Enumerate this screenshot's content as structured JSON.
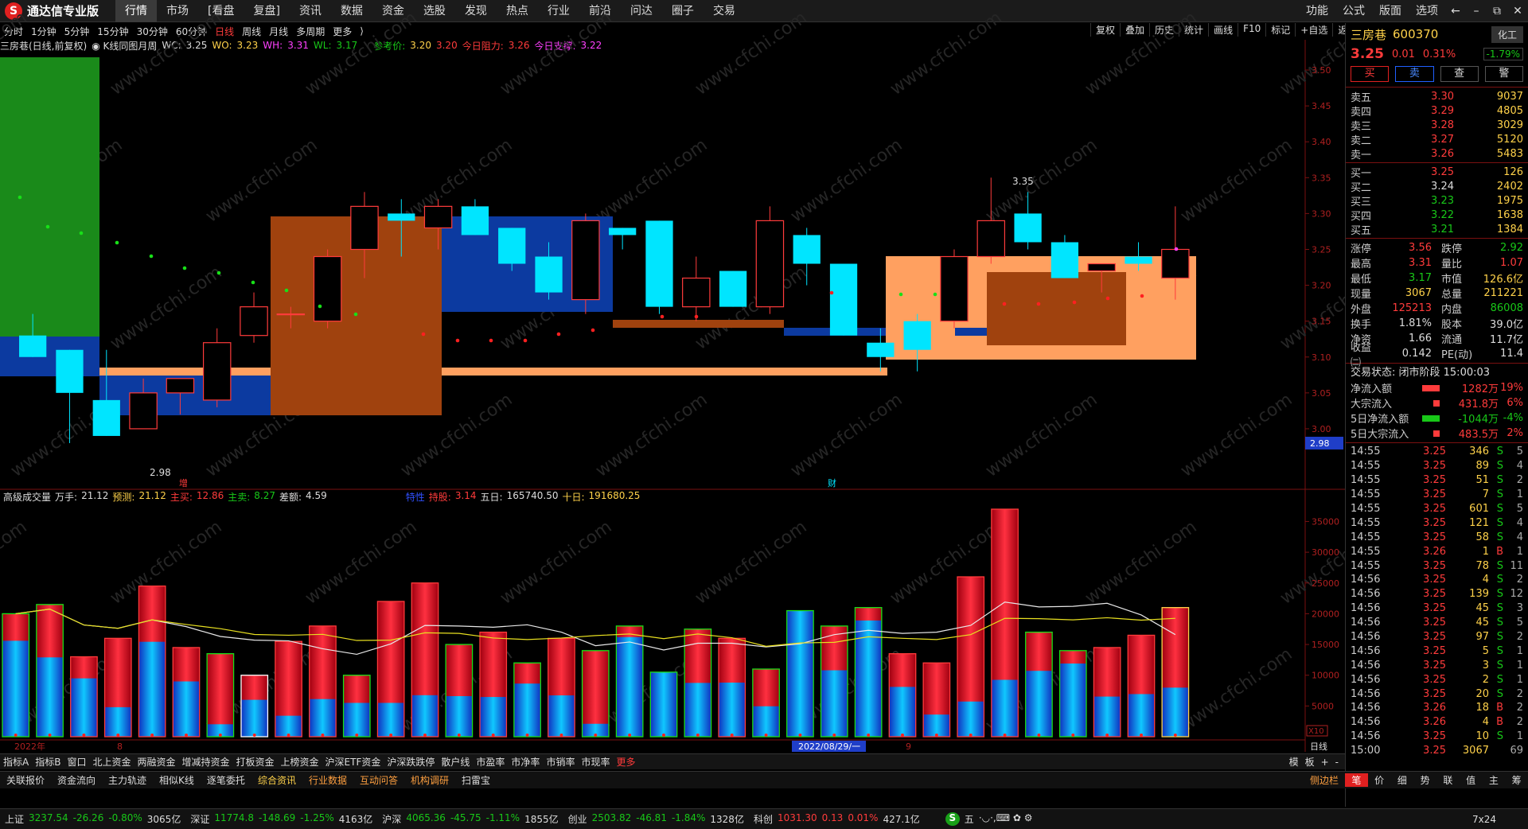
{
  "app": {
    "logo_mark": "S",
    "title": "通达信专业版"
  },
  "menu": [
    "行情",
    "市场",
    "[看盘",
    "复盘]",
    "资讯",
    "数据",
    "资金",
    "选股",
    "发现",
    "热点",
    "行业",
    "前沿",
    "问达",
    "圈子",
    "交易"
  ],
  "menu_right": [
    "功能",
    "公式",
    "版面",
    "选项"
  ],
  "window_btns": [
    "←",
    "–",
    "⧉",
    "✕"
  ],
  "periods": [
    "分时",
    "1分钟",
    "5分钟",
    "15分钟",
    "30分钟",
    "60分钟",
    "日线",
    "周线",
    "月线",
    "多周期",
    "更多"
  ],
  "period_more_arrow": "⟩",
  "active_period": "日线",
  "toolbar_right": [
    "复权",
    "叠加",
    "历史",
    "统计",
    "画线",
    "F10",
    "标记",
    "+自选",
    "返回"
  ],
  "info": {
    "stock": "三房巷(日线,前复权)",
    "indicator": "K线同图月周",
    "wc_label": "WC:",
    "wc": "3.25",
    "wo_label": "WO:",
    "wo": "3.23",
    "wh_label": "WH:",
    "wh": "3.31",
    "wl_label": "WL:",
    "wl": "3.17",
    "ref_label": "参考价:",
    "ref1": "3.20",
    "ref2": "3.20",
    "res_label": "今日阻力:",
    "res": "3.26",
    "sup_label": "今日支撑:",
    "sup": "3.22"
  },
  "vol_info": {
    "name": "高级成交量",
    "wan_label": "万手:",
    "wan": "21.12",
    "pred_label": "预测:",
    "pred": "21.12",
    "zm_label": "主买:",
    "zm": "12.86",
    "zs_label": "主卖:",
    "zs": "8.27",
    "diff_label": "差额:",
    "diff": "4.59",
    "c1": "特性",
    "c2_label": "持股:",
    "c2": "3.14",
    "d5_label": "五日:",
    "d5": "165740.50",
    "d10_label": "十日:",
    "d10": "191680.25"
  },
  "price_axis": [
    "3.50",
    "3.45",
    "3.40",
    "3.35",
    "3.30",
    "3.25",
    "3.20",
    "3.15",
    "3.10",
    "3.05",
    "3.00"
  ],
  "price_tag": "2.98",
  "vol_axis": [
    "35000",
    "30000",
    "25000",
    "20000",
    "15000",
    "10000",
    "5000"
  ],
  "x10": "X10",
  "chart_marks": {
    "hi": "3.35",
    "lo": "2.98",
    "zeng": "增",
    "cai": "财"
  },
  "dates": {
    "year": "2022年",
    "m8": "8",
    "cursor": "2022/08/29/一",
    "m9": "9",
    "period": "日线"
  },
  "chart_data": {
    "type": "candlestick",
    "ylim": [
      2.96,
      3.52
    ],
    "candles": [
      {
        "o": 3.13,
        "h": 3.16,
        "l": 3.1,
        "c": 3.1
      },
      {
        "o": 3.11,
        "h": 3.11,
        "l": 2.98,
        "c": 3.05
      },
      {
        "o": 3.04,
        "h": 3.11,
        "l": 2.99,
        "c": 2.99
      },
      {
        "o": 3.0,
        "h": 3.07,
        "l": 3.0,
        "c": 3.05
      },
      {
        "o": 3.05,
        "h": 3.05,
        "l": 3.02,
        "c": 3.07
      },
      {
        "o": 3.04,
        "h": 3.14,
        "l": 3.03,
        "c": 3.12
      },
      {
        "o": 3.13,
        "h": 3.19,
        "l": 3.12,
        "c": 3.17
      },
      {
        "o": 3.16,
        "h": 3.17,
        "l": 3.14,
        "c": 3.16
      },
      {
        "o": 3.15,
        "h": 3.25,
        "l": 3.14,
        "c": 3.24
      },
      {
        "o": 3.25,
        "h": 3.33,
        "l": 3.21,
        "c": 3.31
      },
      {
        "o": 3.3,
        "h": 3.32,
        "l": 3.24,
        "c": 3.29
      },
      {
        "o": 3.28,
        "h": 3.32,
        "l": 3.25,
        "c": 3.31
      },
      {
        "o": 3.31,
        "h": 3.32,
        "l": 3.27,
        "c": 3.27
      },
      {
        "o": 3.28,
        "h": 3.28,
        "l": 3.22,
        "c": 3.23
      },
      {
        "o": 3.24,
        "h": 3.26,
        "l": 3.18,
        "c": 3.19
      },
      {
        "o": 3.18,
        "h": 3.3,
        "l": 3.16,
        "c": 3.29
      },
      {
        "o": 3.28,
        "h": 3.28,
        "l": 3.25,
        "c": 3.27
      },
      {
        "o": 3.29,
        "h": 3.29,
        "l": 3.16,
        "c": 3.17
      },
      {
        "o": 3.17,
        "h": 3.24,
        "l": 3.15,
        "c": 3.21
      },
      {
        "o": 3.22,
        "h": 3.22,
        "l": 3.17,
        "c": 3.17
      },
      {
        "o": 3.17,
        "h": 3.31,
        "l": 3.16,
        "c": 3.29
      },
      {
        "o": 3.27,
        "h": 3.28,
        "l": 3.2,
        "c": 3.23
      },
      {
        "o": 3.23,
        "h": 3.23,
        "l": 3.13,
        "c": 3.13
      },
      {
        "o": 3.12,
        "h": 3.14,
        "l": 3.08,
        "c": 3.1
      },
      {
        "o": 3.15,
        "h": 3.16,
        "l": 3.08,
        "c": 3.11
      },
      {
        "o": 3.15,
        "h": 3.25,
        "l": 3.14,
        "c": 3.24
      },
      {
        "o": 3.24,
        "h": 3.35,
        "l": 3.23,
        "c": 3.29
      },
      {
        "o": 3.3,
        "h": 3.33,
        "l": 3.25,
        "c": 3.26
      },
      {
        "o": 3.26,
        "h": 3.27,
        "l": 3.21,
        "c": 3.21
      },
      {
        "o": 3.22,
        "h": 3.23,
        "l": 3.19,
        "c": 3.23
      },
      {
        "o": 3.24,
        "h": 3.26,
        "l": 3.22,
        "c": 3.23
      },
      {
        "o": 3.21,
        "h": 3.31,
        "l": 3.18,
        "c": 3.25
      }
    ],
    "volumes": [
      20000,
      21500,
      13000,
      16000,
      24500,
      14500,
      13500,
      10000,
      15500,
      18000,
      10000,
      22000,
      25000,
      15000,
      17000,
      12000,
      16000,
      14000,
      18000,
      10500,
      17500,
      16000,
      11000,
      20500,
      18000,
      21000,
      13500,
      12000,
      26000,
      37000,
      17000,
      14000,
      14500,
      16500,
      21000
    ],
    "vol_split": [
      0.78,
      0.6,
      0.73,
      0.3,
      0.63,
      0.62,
      0.15,
      0.6,
      0.22,
      0.34,
      0.55,
      0.25,
      0.27,
      0.44,
      0.38,
      0.72,
      0.42,
      0.15,
      0.9,
      1.0,
      0.5,
      0.55,
      0.45,
      1.0,
      0.6,
      0.9,
      0.6,
      0.3,
      0.22,
      0.25,
      0.63,
      0.85,
      0.45,
      0.42,
      0.38
    ],
    "ylim_vol": [
      0,
      37000
    ]
  },
  "stock": {
    "name": "三房巷",
    "code": "600370",
    "btn": "化工",
    "price": "3.25",
    "chg": "0.01",
    "pct": "0.31%",
    "sector_pct": "-1.79%",
    "trade_btns": [
      "买",
      "卖",
      "查",
      "警"
    ],
    "asks": [
      [
        "卖五",
        "3.30",
        "9037"
      ],
      [
        "卖四",
        "3.29",
        "4805"
      ],
      [
        "卖三",
        "3.28",
        "3029"
      ],
      [
        "卖二",
        "3.27",
        "5120"
      ],
      [
        "卖一",
        "3.26",
        "5483"
      ]
    ],
    "bids": [
      [
        "买一",
        "3.25",
        "126"
      ],
      [
        "买二",
        "3.24",
        "2402"
      ],
      [
        "买三",
        "3.23",
        "1975"
      ],
      [
        "买四",
        "3.22",
        "1638"
      ],
      [
        "买五",
        "3.21",
        "1384"
      ]
    ],
    "stats": [
      [
        "涨停",
        "3.56",
        "跌停",
        "2.92"
      ],
      [
        "最高",
        "3.31",
        "量比",
        "1.07"
      ],
      [
        "最低",
        "3.17",
        "市值",
        "126.6亿"
      ],
      [
        "现量",
        "3067",
        "总量",
        "211221"
      ],
      [
        "外盘",
        "125213",
        "内盘",
        "86008"
      ],
      [
        "换手",
        "1.81%",
        "股本",
        "39.0亿"
      ],
      [
        "净资",
        "1.66",
        "流通",
        "11.7亿"
      ],
      [
        "收益㈡",
        "0.142",
        "PE(动)",
        "11.4"
      ]
    ],
    "trade_status": "交易状态: 闭市阶段 15:00:03",
    "flows": [
      [
        "净流入额",
        "1282万",
        "19%"
      ],
      [
        "大宗流入",
        "431.8万",
        "6%"
      ],
      [
        "5日净流入额",
        "-1044万",
        "-4%"
      ],
      [
        "5日大宗流入",
        "483.5万",
        "2%"
      ]
    ],
    "ticks": [
      [
        "14:55",
        "3.25",
        "346",
        "S",
        "5"
      ],
      [
        "14:55",
        "3.25",
        "89",
        "S",
        "4"
      ],
      [
        "14:55",
        "3.25",
        "51",
        "S",
        "2"
      ],
      [
        "14:55",
        "3.25",
        "7",
        "S",
        "1"
      ],
      [
        "14:55",
        "3.25",
        "601",
        "S",
        "5"
      ],
      [
        "14:55",
        "3.25",
        "121",
        "S",
        "4"
      ],
      [
        "14:55",
        "3.25",
        "58",
        "S",
        "4"
      ],
      [
        "14:55",
        "3.26",
        "1",
        "B",
        "1"
      ],
      [
        "14:55",
        "3.25",
        "78",
        "S",
        "11"
      ],
      [
        "14:56",
        "3.25",
        "4",
        "S",
        "2"
      ],
      [
        "14:56",
        "3.25",
        "139",
        "S",
        "12"
      ],
      [
        "14:56",
        "3.25",
        "45",
        "S",
        "3"
      ],
      [
        "14:56",
        "3.25",
        "45",
        "S",
        "5"
      ],
      [
        "14:56",
        "3.25",
        "97",
        "S",
        "2"
      ],
      [
        "14:56",
        "3.25",
        "5",
        "S",
        "1"
      ],
      [
        "14:56",
        "3.25",
        "3",
        "S",
        "1"
      ],
      [
        "14:56",
        "3.25",
        "2",
        "S",
        "1"
      ],
      [
        "14:56",
        "3.25",
        "20",
        "S",
        "2"
      ],
      [
        "14:56",
        "3.26",
        "18",
        "B",
        "2"
      ],
      [
        "14:56",
        "3.26",
        "4",
        "B",
        "2"
      ],
      [
        "14:56",
        "3.25",
        "10",
        "S",
        "1"
      ],
      [
        "15:00",
        "3.25",
        "3067",
        "",
        "69"
      ]
    ]
  },
  "bottom_tabs": [
    "指标A",
    "指标B",
    "窗口",
    "北上资金",
    "两融资金",
    "增减持资金",
    "打板资金",
    "上榜资金",
    "沪深ETF资金",
    "沪深跌跌停",
    "散户线",
    "市盈率",
    "市净率",
    "市销率",
    "市现率",
    "更多"
  ],
  "bottom_tabs_right": [
    "模",
    "板",
    "+",
    "-"
  ],
  "bottom_tabs2": [
    "关联报价",
    "资金流向",
    "主力轨迹",
    "相似K线",
    "逐笔委托",
    "综合资讯",
    "行业数据",
    "互动问答",
    "机构调研",
    "扫雷宝"
  ],
  "sidebar_label": "侧边栏",
  "rp_bottom": [
    "笔",
    "价",
    "细",
    "势",
    "联",
    "值",
    "主",
    "筹"
  ],
  "status": [
    {
      "name": "上证",
      "v": "3237.54",
      "c": "-26.26",
      "p": "-0.80%",
      "a": "3065亿"
    },
    {
      "name": "深证",
      "v": "11774.8",
      "c": "-148.69",
      "p": "-1.25%",
      "a": "4163亿"
    },
    {
      "name": "沪深",
      "v": "4065.36",
      "c": "-45.75",
      "p": "-1.11%",
      "a": "1855亿"
    },
    {
      "name": "创业",
      "v": "2503.82",
      "c": "-46.81",
      "p": "-1.84%",
      "a": "1328亿"
    },
    {
      "name": "科创",
      "v": "1031.30",
      "c": "0.13",
      "p": "0.01%",
      "a": "427.1亿"
    }
  ],
  "ime": {
    "logo": "S",
    "label": "五",
    "icons": "·◡·,⌨ ✿ ⚙"
  },
  "clock": "7x24",
  "watermark": "www.cfchi.com"
}
